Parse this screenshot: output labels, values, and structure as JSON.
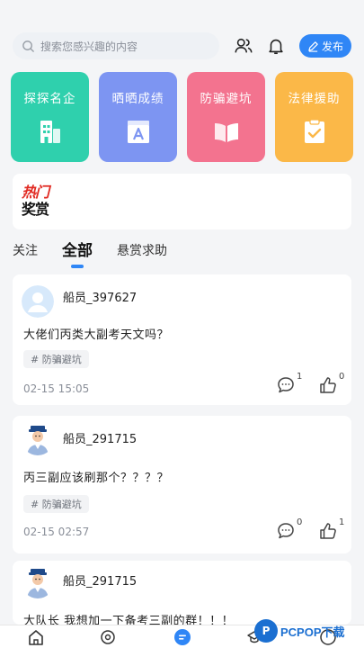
{
  "search": {
    "placeholder": "搜索您感兴趣的内容"
  },
  "header": {
    "publish_label": "发布"
  },
  "categories": [
    {
      "label": "探探名企",
      "color": "#2fd0ad",
      "icon": "building-icon"
    },
    {
      "label": "晒晒成绩",
      "color": "#7d95f2",
      "icon": "grade-a-icon"
    },
    {
      "label": "防骗避坑",
      "color": "#f3738f",
      "icon": "open-book-icon"
    },
    {
      "label": "法律援助",
      "color": "#fbb848",
      "icon": "checklist-icon"
    }
  ],
  "award": {
    "line1": "热门",
    "line2": "奖赏"
  },
  "tabs": [
    {
      "label": "关注",
      "active": false
    },
    {
      "label": "全部",
      "active": true
    },
    {
      "label": "悬赏求助",
      "active": false
    }
  ],
  "posts": [
    {
      "user": "船员_397627",
      "content": "大佬们丙类大副考天文吗？",
      "tag": "# 防骗避坑",
      "time": "02-15 15:05",
      "comments": "1",
      "likes": "0",
      "avatar": "default-avatar"
    },
    {
      "user": "船员_291715",
      "content": "丙三副应该刷那个？？？？",
      "tag": "# 防骗避坑",
      "time": "02-15 02:57",
      "comments": "0",
      "likes": "1",
      "avatar": "sailor-avatar"
    },
    {
      "user": "船员_291715",
      "content": "大队长 我想加一下备考三副的群！！！",
      "avatar": "sailor-avatar"
    }
  ],
  "watermark": {
    "mark": "P",
    "text": "PCPOP下载"
  },
  "colors": {
    "accent": "#2f86f6"
  }
}
